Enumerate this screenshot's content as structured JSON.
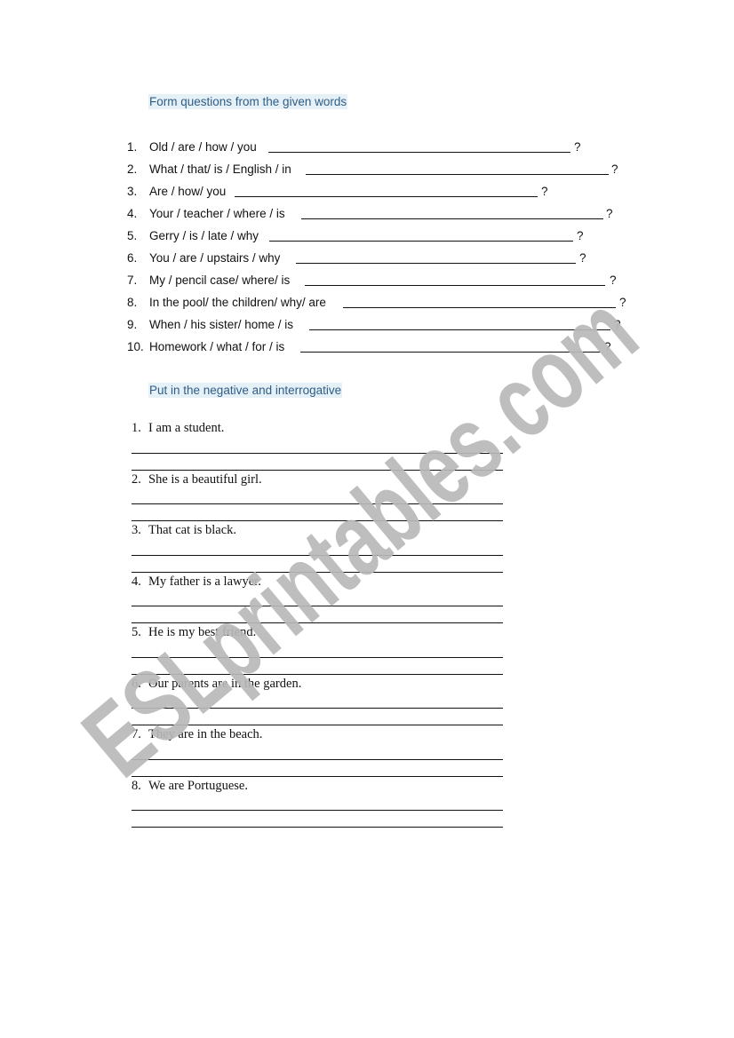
{
  "section1": {
    "heading": "Form questions from the given words",
    "items": [
      {
        "num": "1.",
        "text": "Old / are / how / you",
        "mark": "?"
      },
      {
        "num": "2.",
        "text": "What / that/ is / English / in",
        "mark": "?"
      },
      {
        "num": "3.",
        "text": "Are / how/ you",
        "mark": "?"
      },
      {
        "num": "4.",
        "text": "Your / teacher / where / is",
        "mark": "?"
      },
      {
        "num": "5.",
        "text": "Gerry / is / late / why",
        "mark": "?"
      },
      {
        "num": "6.",
        "text": "You / are / upstairs / why",
        "mark": "?"
      },
      {
        "num": "7.",
        "text": "My / pencil case/ where/ is",
        "mark": "?"
      },
      {
        "num": "8.",
        "text": "In the pool/ the children/ why/ are",
        "mark": "?"
      },
      {
        "num": "9.",
        "text": "When / his sister/ home / is",
        "mark": "?"
      },
      {
        "num": "10.",
        "text": "Homework / what / for / is",
        "mark": "?"
      }
    ]
  },
  "section2": {
    "heading": "Put in the negative and interrogative",
    "items": [
      {
        "num": "1.",
        "text": "I am a student."
      },
      {
        "num": "2.",
        "text": "She is a beautiful girl."
      },
      {
        "num": "3.",
        "text": "That cat is black."
      },
      {
        "num": "4.",
        "text": "My father is a lawyer."
      },
      {
        "num": "5.",
        "text": "He is my best friend."
      },
      {
        "num": "6.",
        "text": "Our parents are in the garden."
      },
      {
        "num": "7.",
        "text": "They are in the beach."
      },
      {
        "num": "8.",
        "text": "We are Portuguese."
      }
    ]
  },
  "watermark": {
    "text": "ESLprintables.com",
    "color": "#b9b9b9"
  },
  "colors": {
    "heading_text": "#2f5d86",
    "heading_highlight": "#e6f0f7"
  }
}
